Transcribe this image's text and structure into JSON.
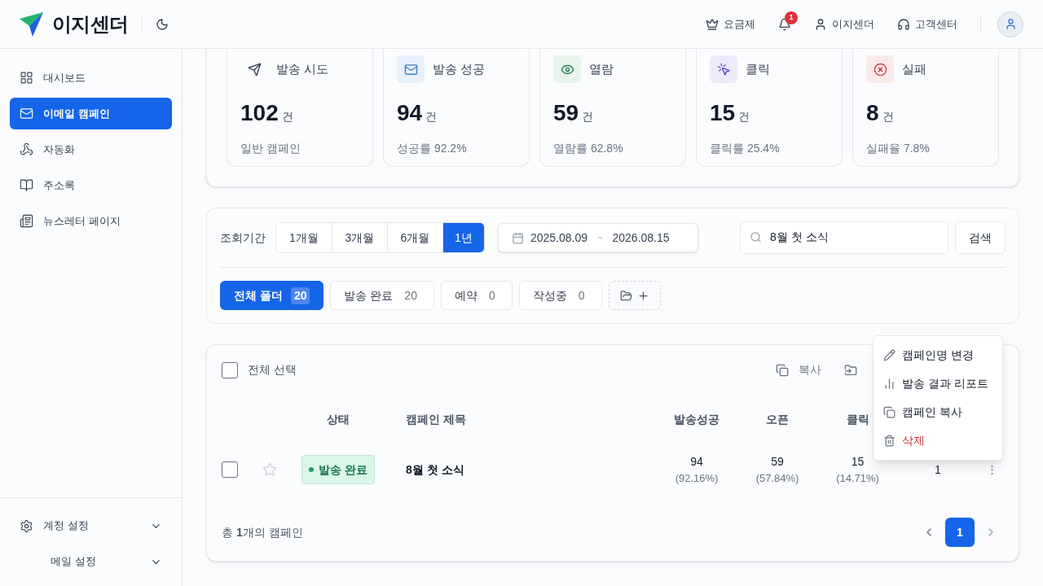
{
  "header": {
    "brand": "이지센더",
    "nav": [
      {
        "kind": "plan",
        "label": "요금제"
      },
      {
        "kind": "bell",
        "badge": "1"
      },
      {
        "kind": "user",
        "label": "이지센더"
      },
      {
        "kind": "support",
        "label": "고객센터"
      }
    ]
  },
  "sidebar": {
    "items": [
      {
        "kind": "dashboard",
        "label": "대시보드",
        "selected": false
      },
      {
        "kind": "mail",
        "label": "이메일 캠페인",
        "selected": true
      },
      {
        "kind": "automation",
        "label": "자동화",
        "selected": false
      },
      {
        "kind": "book",
        "label": "주소록",
        "selected": false
      },
      {
        "kind": "news",
        "label": "뉴스레터 페이지",
        "selected": false
      }
    ],
    "bottom": [
      {
        "kind": "settings",
        "label": "계정 설정",
        "expanded": false
      },
      {
        "kind": "none",
        "label": "메일 설정",
        "expanded": false
      }
    ]
  },
  "stats": [
    {
      "kind": "send",
      "label": "발송 시도",
      "value": "102",
      "unit": "건",
      "note": "일반 캠페인"
    },
    {
      "kind": "mail",
      "label": "발송 성공",
      "value": "94",
      "unit": "건",
      "note": "성공률 92.2%"
    },
    {
      "kind": "eye",
      "label": "열람",
      "value": "59",
      "unit": "건",
      "note": "열람률 62.8%"
    },
    {
      "kind": "click",
      "label": "클릭",
      "value": "15",
      "unit": "건",
      "note": "클릭률 25.4%"
    },
    {
      "kind": "fail",
      "label": "실패",
      "value": "8",
      "unit": "건",
      "note": "실패율 7.8%"
    }
  ],
  "filters": {
    "period_label": "조회기간",
    "periods": [
      {
        "label": "1개월",
        "selected": false
      },
      {
        "label": "3개월",
        "selected": false
      },
      {
        "label": "6개월",
        "selected": false
      },
      {
        "label": "1년",
        "selected": true
      }
    ],
    "date_from": "2025.08.09",
    "date_sep": "~",
    "date_to": "2026.08.15",
    "search_value": "8월 첫 소식",
    "search_button": "검색",
    "folders": [
      {
        "label": "전체 폴더",
        "count": "20",
        "selected": true
      },
      {
        "label": "발송 완료",
        "count": "20",
        "selected": false
      },
      {
        "label": "예약",
        "count": "0",
        "selected": false
      },
      {
        "label": "작성중",
        "count": "0",
        "selected": false
      }
    ]
  },
  "list": {
    "select_all": {
      "label": "전체 선택",
      "checked": false
    },
    "actions": [
      {
        "kind": "copy",
        "label": "복사"
      },
      {
        "kind": "move"
      }
    ],
    "columns": [
      "상태",
      "캠페인 제목",
      "발송성공",
      "오픈",
      "클릭"
    ],
    "rows": [
      {
        "checked": false,
        "starred": false,
        "status": "발송 완료",
        "title": "8월 첫 소식",
        "sent": "94",
        "sent_pct": "(92.16%)",
        "open": "59",
        "open_pct": "(57.84%)",
        "click": "15",
        "click_pct": "(14.71%)",
        "column_8": "1"
      }
    ],
    "total": "총 **1**개의 캠페인",
    "pages": [
      {
        "label": "1",
        "selected": true
      }
    ]
  },
  "menu": [
    {
      "kind": "edit",
      "label": "캠페인명 변경",
      "danger": false
    },
    {
      "kind": "report",
      "label": "발송 결과 리포트",
      "danger": false
    },
    {
      "kind": "copy",
      "label": "캠페인 복사",
      "danger": false
    },
    {
      "kind": "delete",
      "label": "삭제",
      "danger": true
    }
  ]
}
